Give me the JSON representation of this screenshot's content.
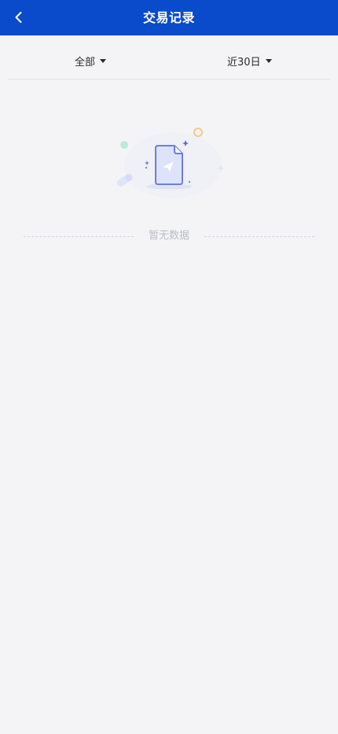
{
  "header": {
    "title": "交易记录",
    "background_color": "#0a4bcc",
    "back_icon": "chevron-left-icon"
  },
  "filters": {
    "type": {
      "selected": "全部"
    },
    "period": {
      "selected": "近30日"
    },
    "caret_icon": "caret-down-icon"
  },
  "empty_state": {
    "text": "暂无数据",
    "illustration_icon": "empty-document-icon"
  }
}
